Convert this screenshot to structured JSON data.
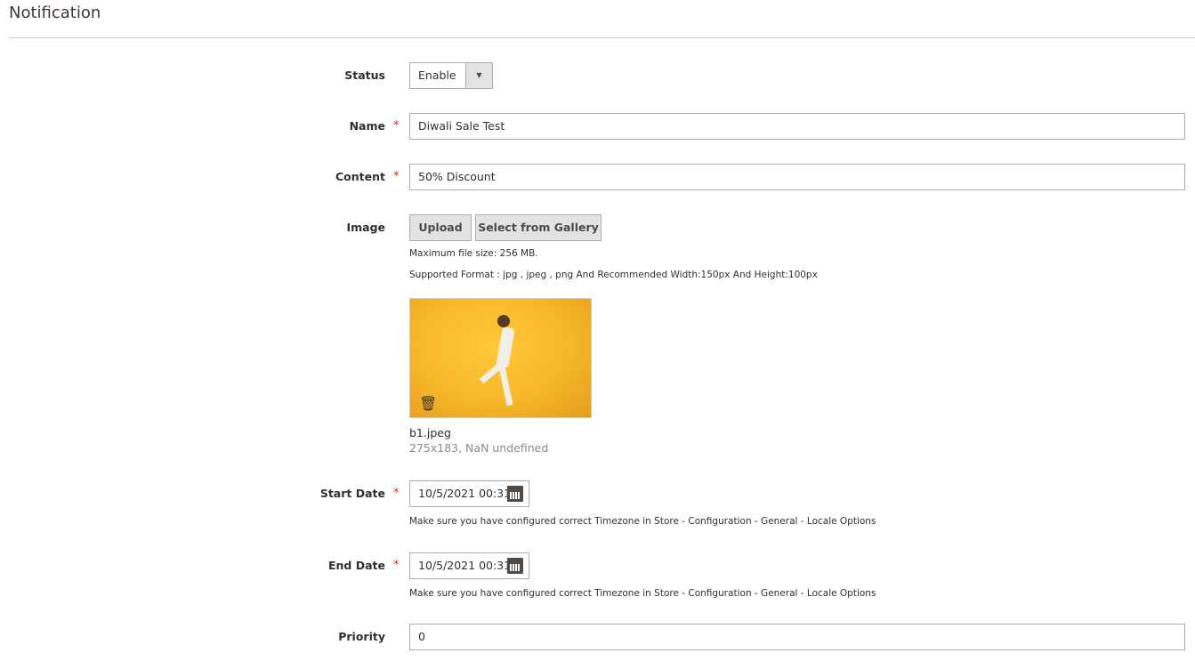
{
  "title": "Notification",
  "fields": {
    "status": {
      "label": "Status",
      "value": "Enable"
    },
    "name": {
      "label": "Name",
      "value": "Diwali Sale Test"
    },
    "content": {
      "label": "Content",
      "value": "50% Discount"
    },
    "image": {
      "label": "Image",
      "upload": "Upload",
      "gallery": "Select from Gallery",
      "max_size": "Maximum file size: 256 MB.",
      "formats": "Supported Format : jpg , jpeg , png And Recommended Width:150px And Height:100px",
      "file_name": "b1.jpeg",
      "file_info": "275x183, NaN undefined"
    },
    "start_date": {
      "label": "Start Date",
      "value": "10/5/2021 00:31",
      "note": "Make sure you have configured correct Timezone in Store - Configuration - General - Locale Options"
    },
    "end_date": {
      "label": "End Date",
      "value": "10/5/2021 00:31",
      "note": "Make sure you have configured correct Timezone in Store - Configuration - General - Locale Options"
    },
    "priority": {
      "label": "Priority",
      "value": "0"
    }
  },
  "required_mark": "*",
  "colors": {
    "required": "#e22626",
    "image_bg": "#f6b829"
  }
}
